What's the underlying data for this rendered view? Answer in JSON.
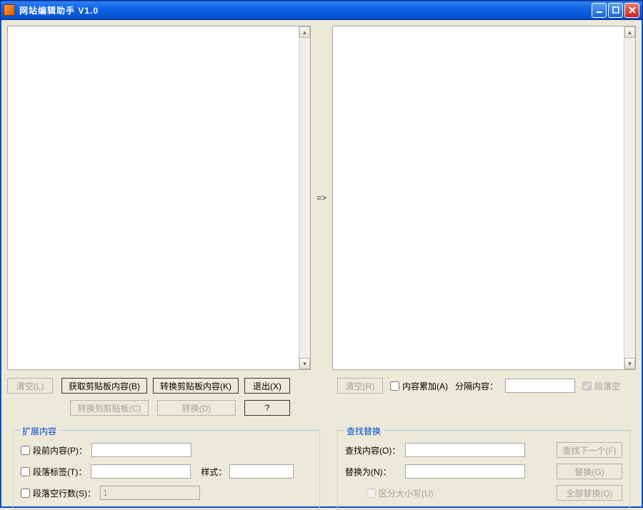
{
  "window": {
    "title": "网站编辑助手  V1.0"
  },
  "arrow": "=>",
  "left_buttons": {
    "clear": "清空(L)",
    "get_clipboard": "获取剪贴板内容(B)",
    "convert_clipboard": "转换剪贴板内容(K)",
    "exit": "退出(X)",
    "convert_to_clipboard": "转换到剪贴板(C)",
    "convert": "转换(D)",
    "help": "?"
  },
  "right_row": {
    "clear": "清空(R)",
    "accumulate": "内容累加(A)",
    "separator_label": "分隔内容：",
    "separator_value": "",
    "empty_paragraph": "段落空"
  },
  "extend": {
    "title": "扩展内容",
    "prefix_label": "段前内容(P)：",
    "prefix_value": "",
    "tag_label": "段落标签(T)：",
    "tag_value": "",
    "style_label": "样式：",
    "style_value": "",
    "blank_lines_label": "段落空行数(S)：",
    "blank_lines_value": "1"
  },
  "find": {
    "title": "查找替换",
    "find_label": "查找内容(O)：",
    "find_value": "",
    "replace_label": "替换为(N)：",
    "replace_value": "",
    "case_label": "区分大小写(U)",
    "find_next": "查找下一个(F)",
    "replace": "替换(G)",
    "replace_all": "全部替换(Q)"
  },
  "textareas": {
    "left": "",
    "right": ""
  }
}
